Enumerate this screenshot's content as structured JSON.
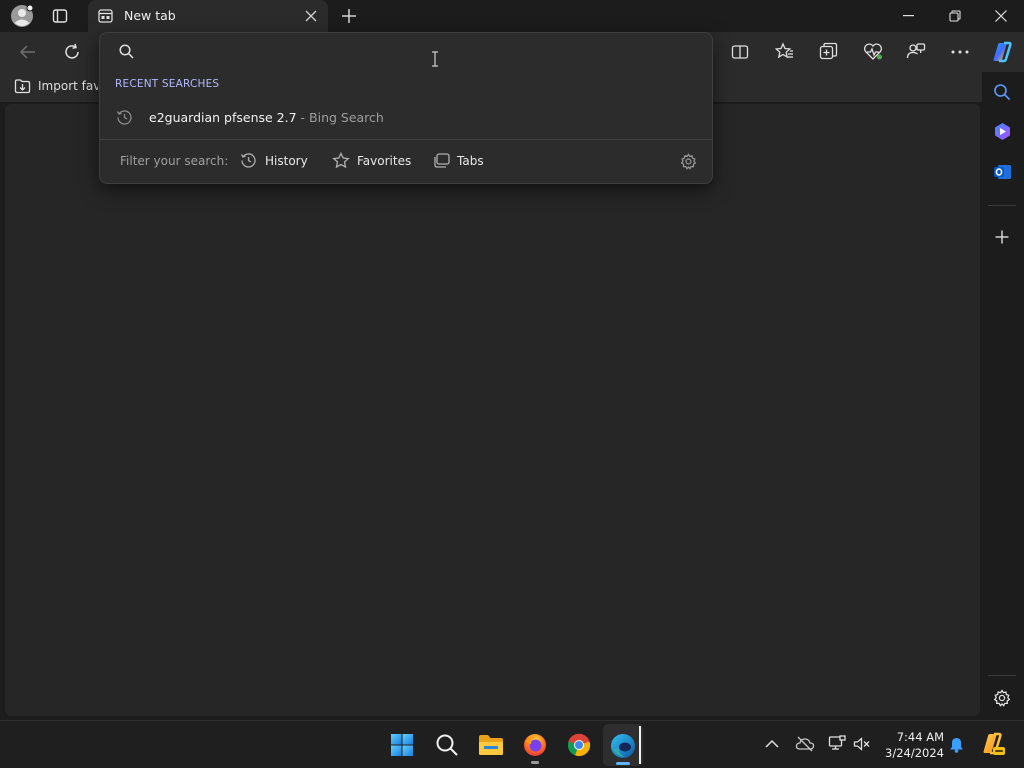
{
  "tab": {
    "title": "New tab"
  },
  "favorites_bar": {
    "import_label": "Import favorites"
  },
  "search_dropdown": {
    "recent_header": "RECENT SEARCHES",
    "recent_items": [
      {
        "query": "e2guardian pfsense 2.7",
        "suffix": " - Bing Search"
      }
    ],
    "filter_label": "Filter your search:",
    "filters": [
      "History",
      "Favorites",
      "Tabs"
    ]
  },
  "taskbar": {
    "time": "7:44 AM",
    "date": "3/24/2024"
  },
  "colors": {
    "accent": "#b5b9ff",
    "window_bg": "#1c1c1c",
    "toolbar_bg": "#2b2b2b",
    "content_bg": "#262626"
  }
}
